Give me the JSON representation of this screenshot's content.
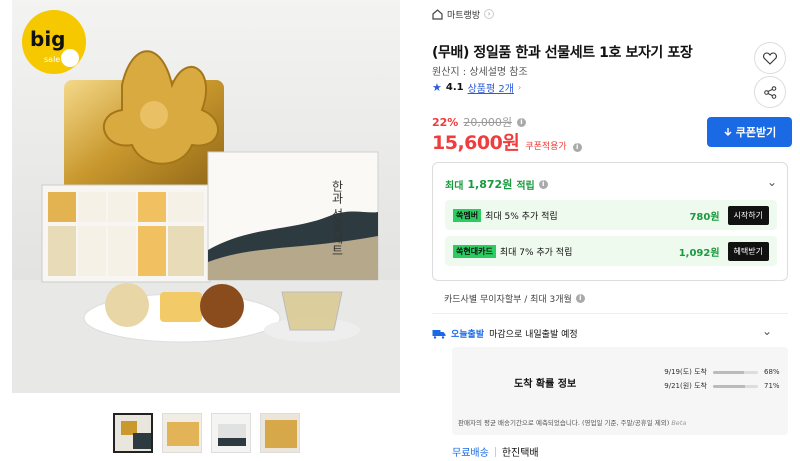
{
  "gallery": {
    "badge_text": "big",
    "badge_sub": "sale",
    "box_label": "한과 선물세트",
    "thumbnail_count": 4
  },
  "store": {
    "name": "마트랭방",
    "chevron": "›"
  },
  "product": {
    "title": "(무배) 정일품 한과 선물세트 1호 보자기 포장",
    "origin": "원산지 : 상세설명 참조",
    "rating": "4.1",
    "review_link": "상품평 2개",
    "discount": "22%",
    "original_price": "20,000원",
    "price": "15,600원",
    "coupon_label": "쿠폰적용가",
    "coupon_button": "쿠폰받기"
  },
  "points": {
    "prefix": "최대",
    "amount": "1,872원",
    "suffix": "적립",
    "promos": [
      {
        "mark": "쏙",
        "brand": "멤버",
        "text": "최대 5% 추가 적립",
        "amount": "780원",
        "action": "시작하기"
      },
      {
        "mark": "쏙",
        "brand": "현대카드",
        "text": "최대 7% 추가 적립",
        "amount": "1,092원",
        "action": "혜택받기"
      }
    ]
  },
  "card_info": "카드사별 무이자할부 / 최대 3개월",
  "shipping": {
    "today_label": "오늘출발",
    "today_text": "마감으로 내일출발 예정",
    "box_title": "도착 확률 정보",
    "lines": [
      {
        "date": "9/19(도) 도착",
        "percent_text": "68%",
        "percent": 68
      },
      {
        "date": "9/21(원) 도착",
        "percent_text": "71%",
        "percent": 71
      }
    ],
    "note": "판매자의 평균 배송기간으로 예측되었습니다. (영업일 기준, 주말/공휴일 제외)",
    "beta": "Beta",
    "free_label": "무료배송",
    "carrier": "한진택배"
  },
  "colors": {
    "accent_blue": "#1a6ae6",
    "price_red": "#f03c3c",
    "point_green": "#1a9a3f",
    "badge_yellow": "#f5c800"
  }
}
